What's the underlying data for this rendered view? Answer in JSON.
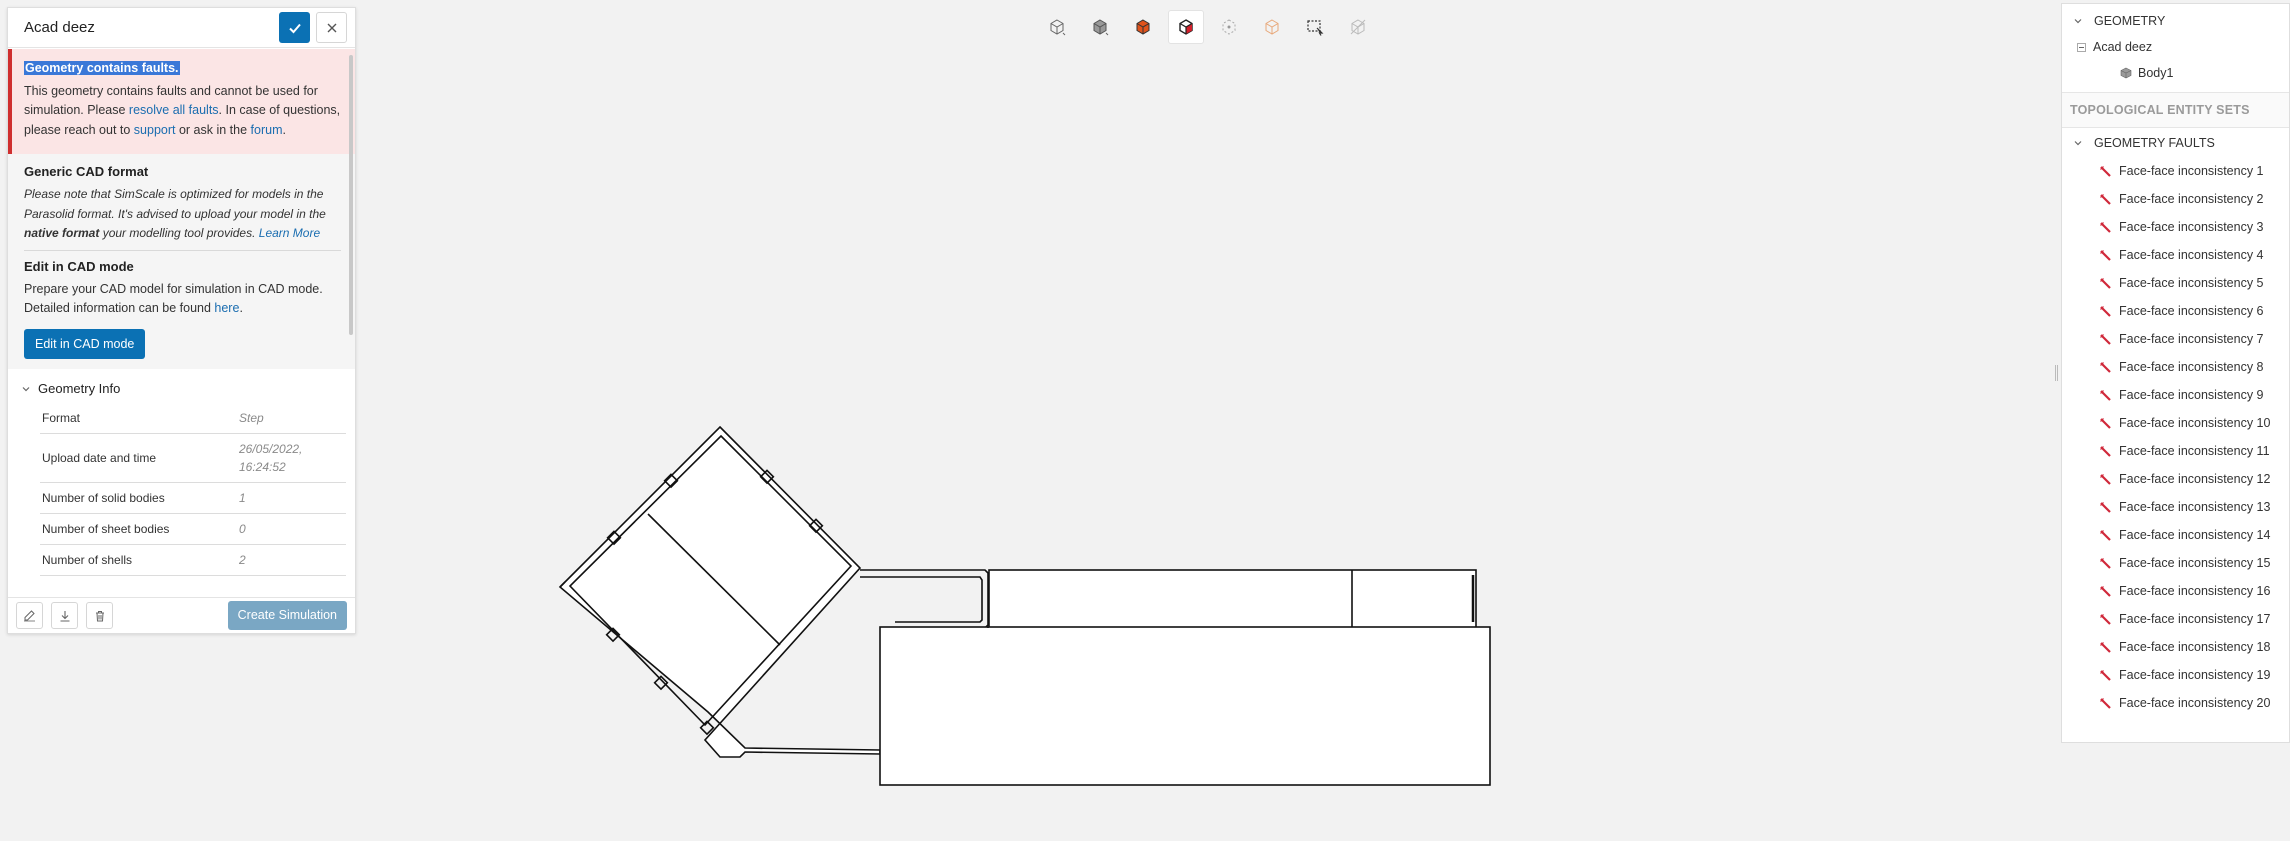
{
  "left_panel": {
    "title": "Acad deez",
    "fault": {
      "title": "Geometry contains faults.",
      "text_1": "This geometry contains faults and cannot be used for simulation. Please ",
      "link_resolve": "resolve all faults",
      "text_2": ". In case of questions, please reach out to ",
      "link_support": "support",
      "text_3": " or ask in the ",
      "link_forum": "forum",
      "text_4": "."
    },
    "generic_cad": {
      "title": "Generic CAD format",
      "text_1": "Please note that SimScale is optimized for models in the Parasolid format. It's advised to upload your model in the ",
      "bold": "native format",
      "text_2": " your modelling tool provides. ",
      "link": "Learn More"
    },
    "edit_cad": {
      "title": "Edit in CAD mode",
      "text_1": "Prepare your CAD model for simulation in CAD mode. Detailed information can be found ",
      "link": "here",
      "text_2": ".",
      "button": "Edit in CAD mode"
    },
    "geometry_info": {
      "title": "Geometry Info",
      "rows": [
        {
          "label": "Format",
          "value": "Step"
        },
        {
          "label": "Upload date and time",
          "value": "26/05/2022, 16:24:52"
        },
        {
          "label": "Number of solid bodies",
          "value": "1"
        },
        {
          "label": "Number of sheet bodies",
          "value": "0"
        },
        {
          "label": "Number of shells",
          "value": "2"
        }
      ]
    },
    "footer": {
      "create_button": "Create Simulation"
    }
  },
  "toolbar": {
    "icons": [
      "cube-outline-icon",
      "cube-shaded-icon",
      "cube-orange-icon",
      "cube-selection-icon",
      "vertex-select-icon",
      "cube-transparent-icon",
      "box-select-icon",
      "hide-icon"
    ]
  },
  "right_panel": {
    "geometry_section": "GEOMETRY",
    "geometry_name": "Acad deez",
    "body_name": "Body1",
    "topological_section": "TOPOLOGICAL ENTITY SETS",
    "faults_section": "GEOMETRY FAULTS",
    "faults": [
      "Face-face inconsistency 1",
      "Face-face inconsistency 2",
      "Face-face inconsistency 3",
      "Face-face inconsistency 4",
      "Face-face inconsistency 5",
      "Face-face inconsistency 6",
      "Face-face inconsistency 7",
      "Face-face inconsistency 8",
      "Face-face inconsistency 9",
      "Face-face inconsistency 10",
      "Face-face inconsistency 11",
      "Face-face inconsistency 12",
      "Face-face inconsistency 13",
      "Face-face inconsistency 14",
      "Face-face inconsistency 15",
      "Face-face inconsistency 16",
      "Face-face inconsistency 17",
      "Face-face inconsistency 18",
      "Face-face inconsistency 19",
      "Face-face inconsistency 20"
    ]
  },
  "colors": {
    "accent": "#0b71b4",
    "fault_bg": "#fbe5e5",
    "fault_border": "#cf2f2f",
    "fault_icon": "#d0283a"
  }
}
